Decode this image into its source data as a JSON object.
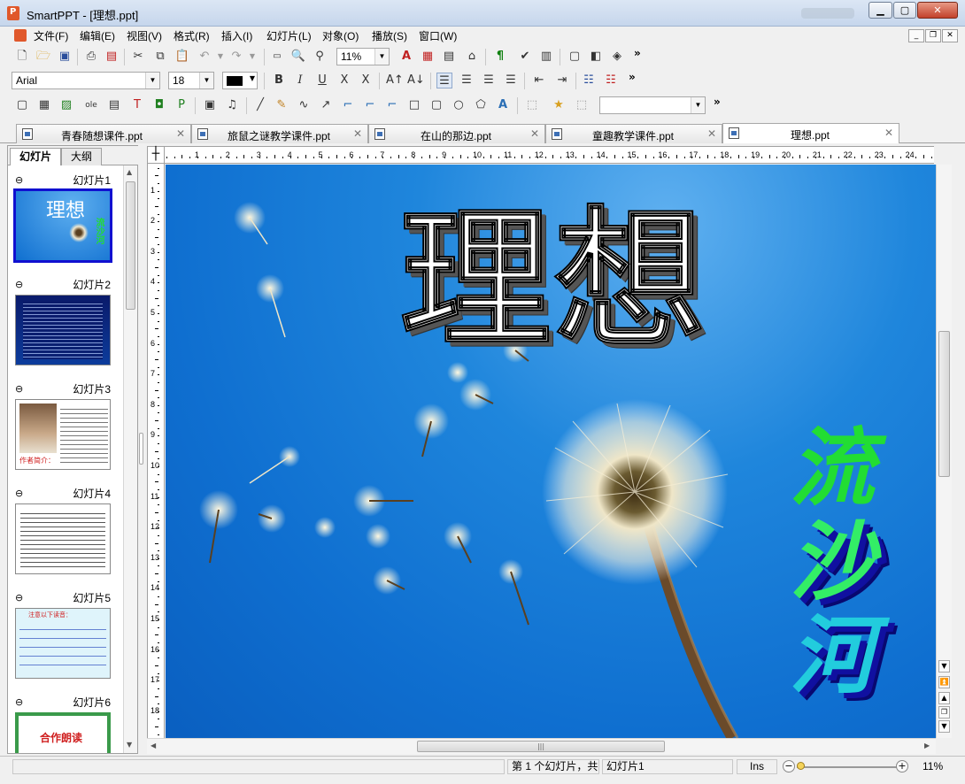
{
  "window": {
    "title": "SmartPPT - [理想.ppt]"
  },
  "menu": [
    "文件(F)",
    "编辑(E)",
    "视图(V)",
    "格式(R)",
    "插入(I)",
    "幻灯片(L)",
    "对象(O)",
    "播放(S)",
    "窗口(W)"
  ],
  "toolbar": {
    "zoom": "11%",
    "font_name": "Arial",
    "font_size": "18",
    "more": "»",
    "text_color": "#000000"
  },
  "doc_tabs": [
    {
      "label": "青春随想课件.ppt"
    },
    {
      "label": "旅鼠之谜教学课件.ppt"
    },
    {
      "label": "在山的那边.ppt"
    },
    {
      "label": "童趣教学课件.ppt"
    },
    {
      "label": "理想.ppt",
      "active": true
    }
  ],
  "panel_tabs": [
    "幻灯片",
    "大纲"
  ],
  "slides": [
    {
      "label": "幻灯片1",
      "title": "理想",
      "subtitle": "流沙河"
    },
    {
      "label": "幻灯片2"
    },
    {
      "label": "幻灯片3",
      "caption": "作者简介："
    },
    {
      "label": "幻灯片4"
    },
    {
      "label": "幻灯片5",
      "heading": "注意以下读音："
    },
    {
      "label": "幻灯片6",
      "heading": "合作朗读"
    }
  ],
  "ruler": {
    "h": [
      "1",
      "2",
      "3",
      "4",
      "5",
      "6",
      "7",
      "8",
      "9",
      "10",
      "11",
      "12",
      "13",
      "14",
      "15",
      "16",
      "17",
      "18",
      "19",
      "20",
      "21",
      "22",
      "23",
      "24",
      "25"
    ],
    "v": [
      "1",
      "2",
      "3",
      "4",
      "5",
      "6",
      "7",
      "8",
      "9",
      "10",
      "11",
      "12",
      "13",
      "14",
      "15",
      "16",
      "17",
      "18"
    ]
  },
  "slide": {
    "title": "理想",
    "vertical_text": [
      "流",
      "沙",
      "河"
    ],
    "colors": {
      "sky": "#1f86dc",
      "title_fill": "#ffffff",
      "vertical_fill": "#22dd33",
      "vertical_shadow": "#1010a0"
    }
  },
  "status": {
    "slide_info": "第 1 个幻灯片，共",
    "slide_name": "幻灯片1",
    "mode": "Ins",
    "zoom": "11%"
  }
}
